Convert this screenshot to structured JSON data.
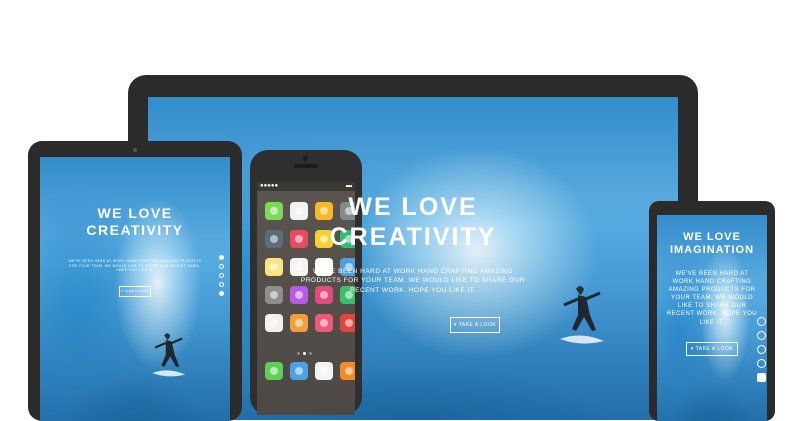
{
  "monitor": {
    "title_line1": "WE LOVE",
    "title_line2": "CREATIVITY",
    "subtitle_line1": "WE'VE BEEN HARD AT WORK HAND CRAFTING AMAZING",
    "subtitle_line2": "PRODUCTS FOR YOUR TEAM. WE WOULD LIKE TO SHARE OUR",
    "subtitle_line3": "RECENT WORK. HOPE YOU LIKE IT.",
    "cta_label": "▾ TAKE A LOOK"
  },
  "tablet": {
    "title_line1": "WE LOVE",
    "title_line2": "CREATIVITY",
    "subtitle_line1": "WE'VE BEEN HARD AT WORK HAND CRAFTING AMAZING PRODUCTS",
    "subtitle_line2": "FOR YOUR TEAM. WE WOULD LIKE TO SHARE OUR RECENT WORK.",
    "subtitle_line3": "HOPE YOU LIKE IT.",
    "cta_label": "▾ TAKE A LOOK",
    "nav_dots": 5
  },
  "phone": {
    "status_carrier": "●●●●●",
    "status_battery": "▬"
  },
  "small_device": {
    "title_line1": "WE LOVE",
    "title_line2": "IMAGINATION",
    "subtitle_line1": "WE'VE BEEN HARD AT",
    "subtitle_line2": "WORK HAND CRAFTING",
    "subtitle_line3": "AMAZING PRODUCTS FOR",
    "subtitle_line4": "YOUR TEAM. WE WOULD",
    "subtitle_line5": "LIKE TO SHARE OUR",
    "subtitle_line6": "RECENT WORK. HOPE YOU",
    "subtitle_line7": "LIKE IT.",
    "cta_label": "▾ TAKE A LOOK"
  },
  "colors": {
    "device_bezel": "#2b2b2b",
    "screen_blue": "#3b9ad8"
  },
  "phone_apps": [
    {
      "name": "messages-app-icon",
      "color": "#7ed957"
    },
    {
      "name": "calendar-app-icon",
      "color": "#f2f2f2"
    },
    {
      "name": "photos-app-icon",
      "color": "#f6b928"
    },
    {
      "name": "camera-app-icon",
      "color": "#7f8c8d"
    },
    {
      "name": "videos-app-icon",
      "color": "#5a6d7a"
    },
    {
      "name": "calendar-red-app-icon",
      "color": "#e84a5f"
    },
    {
      "name": "clock-app-icon",
      "color": "#f6d02f"
    },
    {
      "name": "maps-app-icon",
      "color": "#35b979"
    },
    {
      "name": "notes-app-icon",
      "color": "#fbe37d"
    },
    {
      "name": "reminders-app-icon",
      "color": "#f4f4f4"
    },
    {
      "name": "gamecenter-app-icon",
      "color": "#fefefe"
    },
    {
      "name": "stocks-app-icon",
      "color": "#4aa3df"
    },
    {
      "name": "settings-app-icon",
      "color": "#8e8e8e"
    },
    {
      "name": "podcasts-app-icon",
      "color": "#b55be8"
    },
    {
      "name": "itunes-app-icon",
      "color": "#e14b7d"
    },
    {
      "name": "passbook-app-icon",
      "color": "#3bbf6a"
    },
    {
      "name": "chrome-app-icon",
      "color": "#f1f1f1"
    },
    {
      "name": "ibooks-app-icon",
      "color": "#f29e3b"
    },
    {
      "name": "flower-app-icon",
      "color": "#ef5a78"
    },
    {
      "name": "newsstand-app-icon",
      "color": "#e0443c"
    }
  ],
  "dock_apps": [
    {
      "name": "phone-app-icon",
      "color": "#5fcf57"
    },
    {
      "name": "mail-app-icon",
      "color": "#4aa3df"
    },
    {
      "name": "safari-app-icon",
      "color": "#f4f4f4"
    },
    {
      "name": "music-app-icon",
      "color": "#f28c28"
    }
  ]
}
